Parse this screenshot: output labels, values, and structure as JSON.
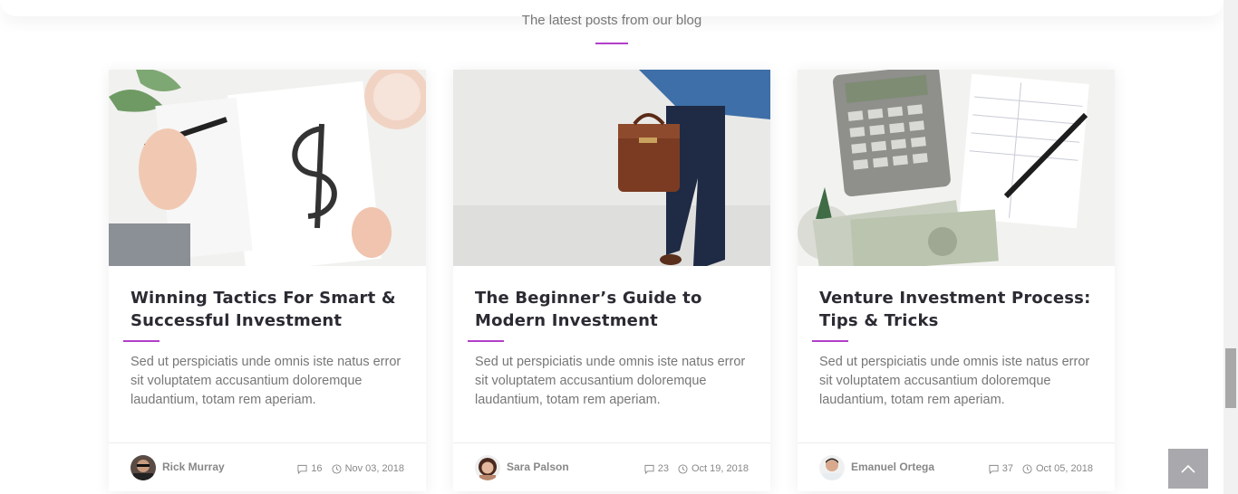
{
  "section": {
    "subtitle": "The latest posts from our blog",
    "accent_color": "#b13fc8"
  },
  "posts": [
    {
      "image": "notebook-dollar-sign-photo",
      "title_line1": "Winning Tactics For Smart &",
      "title_line2": "Successful Investment",
      "excerpt": "Sed ut perspiciatis unde omnis iste natus error sit voluptatem accusantium doloremque laudantium, totam rem aperiam.",
      "author": "Rick Murray",
      "comments": "16",
      "date": "Nov 03, 2018"
    },
    {
      "image": "businessman-briefcase-photo",
      "title_line1": "The Beginner’s Guide to",
      "title_line2": "Modern Investment",
      "excerpt": "Sed ut perspiciatis unde omnis iste natus error sit voluptatem accusantium doloremque laudantium, totam rem aperiam.",
      "author": "Sara Palson",
      "comments": "23",
      "date": "Oct 19, 2018"
    },
    {
      "image": "calculator-money-pen-photo",
      "title_line1": "Venture Investment Process:",
      "title_line2": "Tips & Tricks",
      "excerpt": "Sed ut perspiciatis unde omnis iste natus error sit voluptatem accusantium doloremque laudantium, totam rem aperiam.",
      "author": "Emanuel Ortega",
      "comments": "37",
      "date": "Oct 05, 2018"
    }
  ],
  "icons": {
    "comment": "comment-icon",
    "clock": "clock-icon",
    "back_to_top": "chevron-up-icon"
  }
}
